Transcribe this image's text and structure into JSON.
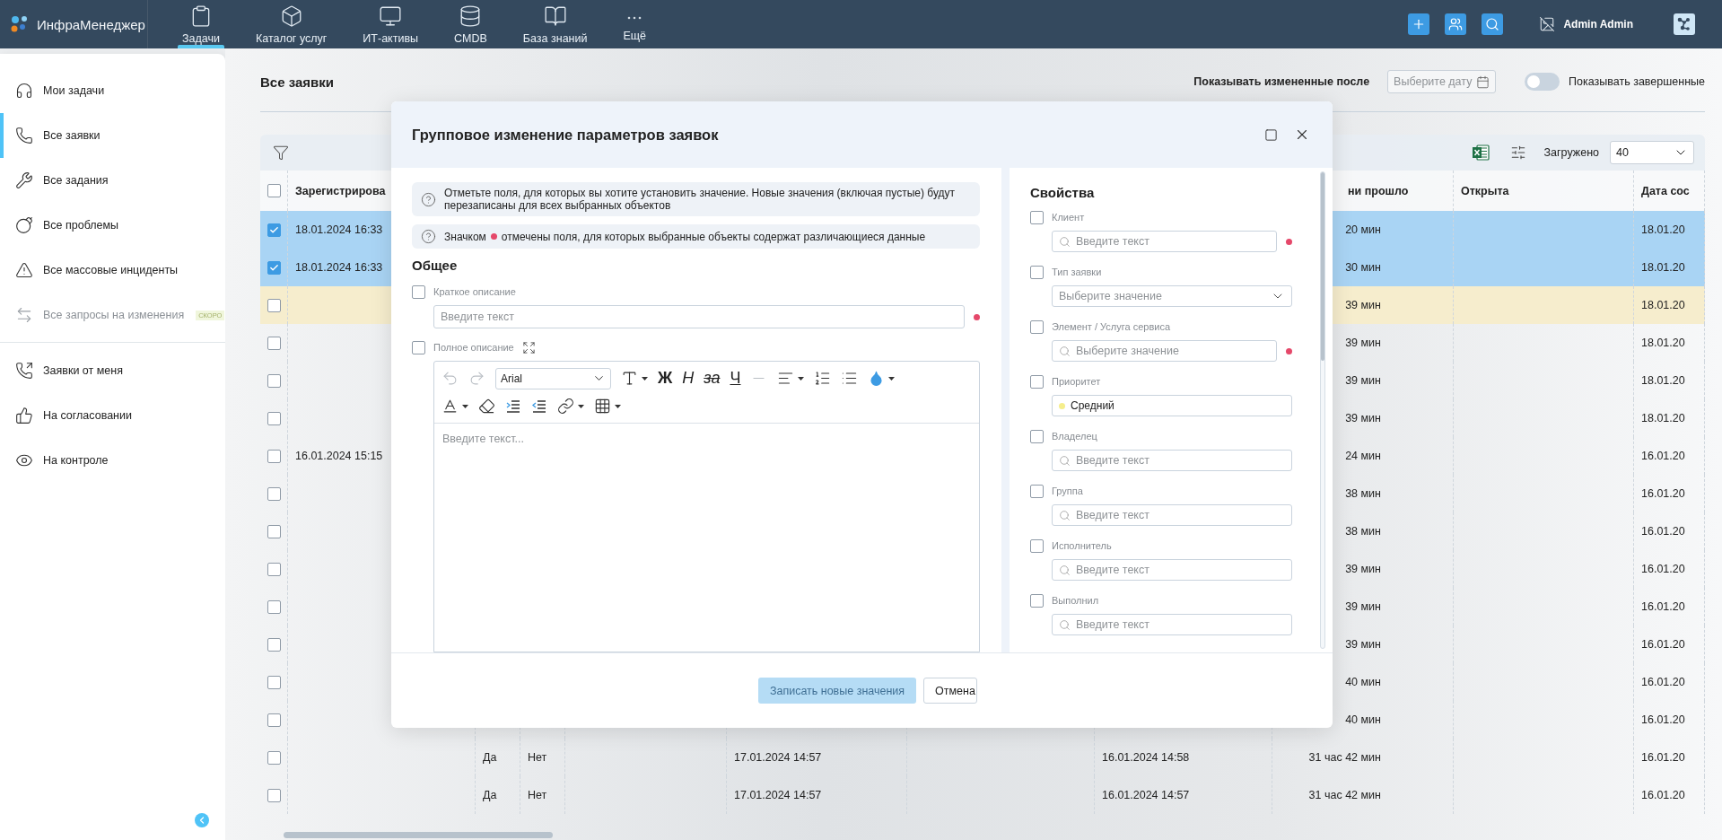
{
  "topbar": {
    "brand": "ИнфраМенеджер",
    "nav": [
      {
        "label": "Задачи",
        "selected": true
      },
      {
        "label": "Каталог услуг",
        "selected": false
      },
      {
        "label": "ИТ-активы",
        "selected": false
      },
      {
        "label": "CMDB",
        "selected": false
      },
      {
        "label": "База знаний",
        "selected": false
      },
      {
        "label": "Ещё",
        "selected": false
      }
    ],
    "actions": [
      {
        "kind": "add"
      },
      {
        "kind": "users"
      },
      {
        "kind": "search"
      }
    ],
    "user": {
      "name": "Admin Admin"
    }
  },
  "sidebar": {
    "groups": [
      [
        {
          "label": "Мои задачи",
          "selected": false,
          "disabled": false
        },
        {
          "label": "Все заявки",
          "selected": true,
          "disabled": false
        },
        {
          "label": "Все задания",
          "selected": false,
          "disabled": false
        },
        {
          "label": "Все проблемы",
          "selected": false,
          "disabled": false
        },
        {
          "label": "Все массовые инциденты",
          "selected": false,
          "disabled": false
        },
        {
          "label": "Все запросы на изменения",
          "selected": false,
          "disabled": true,
          "badge": "СКОРО"
        }
      ],
      [
        {
          "label": "Заявки от меня",
          "selected": false,
          "disabled": false
        },
        {
          "label": "На согласовании",
          "selected": false,
          "disabled": false
        },
        {
          "label": "На контроле",
          "selected": false,
          "disabled": false
        }
      ]
    ]
  },
  "page": {
    "title": "Все заявки",
    "changed_after": {
      "label": "Показывать измененные после",
      "placeholder": "Выберите дату"
    },
    "show_done": {
      "label": "Показывать завершенные",
      "on": false
    }
  },
  "table": {
    "loaded": {
      "label": "Загружено",
      "value": "40"
    },
    "header_checked": false,
    "columns": {
      "registered": "Зарегистрирова",
      "elapsed": "ни прошло",
      "opened": "Открыта",
      "date": "Дата сос"
    },
    "rows": [
      {
        "checked": true,
        "highlighted": false,
        "registered": "18.01.2024 16:33",
        "elapsed": "20 мин",
        "date": "18.01.20"
      },
      {
        "checked": true,
        "highlighted": false,
        "registered": "18.01.2024 16:33",
        "elapsed": "30 мин",
        "date": "18.01.20"
      },
      {
        "checked": false,
        "highlighted": true,
        "elapsed": "39 мин",
        "date": "18.01.20"
      },
      {
        "checked": false,
        "highlighted": false,
        "elapsed": "39 мин",
        "date": "18.01.20"
      },
      {
        "checked": false,
        "highlighted": false,
        "elapsed": "39 мин",
        "date": "18.01.20"
      },
      {
        "checked": false,
        "highlighted": false,
        "elapsed": "39 мин",
        "date": "18.01.20"
      },
      {
        "checked": false,
        "highlighted": false,
        "registered": "16.01.2024 15:15",
        "elapsed": "24 мин",
        "date": "16.01.20"
      },
      {
        "checked": false,
        "highlighted": false,
        "elapsed": "38 мин",
        "date": "16.01.20"
      },
      {
        "checked": false,
        "highlighted": false,
        "elapsed": "38 мин",
        "date": "16.01.20"
      },
      {
        "checked": false,
        "highlighted": false,
        "elapsed": "39 мин",
        "date": "16.01.20"
      },
      {
        "checked": false,
        "highlighted": false,
        "elapsed": "39 мин",
        "date": "16.01.20"
      },
      {
        "checked": false,
        "highlighted": false,
        "elapsed": "39 мин",
        "date": "16.01.20"
      },
      {
        "checked": false,
        "highlighted": false,
        "elapsed": "40 мин",
        "date": "16.01.20"
      },
      {
        "checked": false,
        "highlighted": false,
        "elapsed": "40 мин",
        "date": "16.01.20"
      },
      {
        "checked": false,
        "highlighted": false,
        "column_3": "Да",
        "column_4": "Нет",
        "column_6": "17.01.2024 14:57",
        "column_8": "16.01.2024 14:58",
        "elapsed": "31 час 42 мин",
        "date": "16.01.20"
      },
      {
        "checked": false,
        "highlighted": false,
        "column_3": "Да",
        "column_4": "Нет",
        "column_6": "17.01.2024 14:57",
        "column_8": "16.01.2024 14:57",
        "elapsed": "31 час 42 мин",
        "date": "16.01.20"
      }
    ]
  },
  "modal": {
    "title": "Групповое изменение параметров заявок",
    "info": [
      {
        "kind": "plain",
        "text": "Отметьте поля, для которых вы хотите установить значение. Новые значения (включая пустые) будут перезаписаны для всех выбранных объектов"
      },
      {
        "kind": "legend",
        "before": "Значком",
        "after": "отмечены поля, для которых выбранные объекты содержат различающиеся данные"
      }
    ],
    "general": {
      "heading": "Общее",
      "fields": [
        {
          "kind": "text",
          "label": "Краткое описание",
          "placeholder": "Введите текст",
          "checked": false,
          "differs": true
        },
        {
          "kind": "rich",
          "label": "Полное описание",
          "placeholder": "Введите текст...",
          "checked": false,
          "toolbar": [
            [
              {
                "kind": "undo",
                "disabled": true
              },
              {
                "kind": "redo",
                "disabled": true
              },
              {
                "kind": "font",
                "value": "Arial"
              },
              {
                "kind": "size",
                "caret": true
              },
              {
                "kind": "bold",
                "label": "Ж"
              },
              {
                "kind": "italic",
                "label": "Н"
              },
              {
                "kind": "strike",
                "label": "за"
              },
              {
                "kind": "underline",
                "label": "Ч"
              },
              {
                "kind": "rule",
                "disabled": true
              },
              {
                "kind": "align",
                "caret": true
              },
              {
                "kind": "ol"
              },
              {
                "kind": "ul"
              },
              {
                "kind": "color",
                "caret": true
              }
            ],
            [
              {
                "kind": "highlight",
                "caret": true
              },
              {
                "kind": "eraser"
              },
              {
                "kind": "indent"
              },
              {
                "kind": "outdent"
              },
              {
                "kind": "link",
                "caret": true
              },
              {
                "kind": "table",
                "caret": true
              }
            ]
          ]
        }
      ]
    },
    "properties": {
      "heading": "Свойства",
      "fields": [
        {
          "kind": "search",
          "label": "Клиент",
          "placeholder": "Введите текст",
          "checked": false,
          "differs": true
        },
        {
          "kind": "select",
          "label": "Тип заявки",
          "placeholder": "Выберите значение",
          "checked": false,
          "differs": false
        },
        {
          "kind": "search",
          "label": "Элемент / Услуга сервиса",
          "placeholder": "Выберите значение",
          "checked": false,
          "differs": true
        },
        {
          "kind": "value",
          "label": "Приоритет",
          "value": "Средний",
          "color": "#f5ee8c",
          "checked": false,
          "differs": false
        },
        {
          "kind": "search",
          "label": "Владелец",
          "placeholder": "Введите текст",
          "checked": false,
          "differs": false
        },
        {
          "kind": "search",
          "label": "Группа",
          "placeholder": "Введите текст",
          "checked": false,
          "differs": false
        },
        {
          "kind": "search",
          "label": "Исполнитель",
          "placeholder": "Введите текст",
          "checked": false,
          "differs": false
        },
        {
          "kind": "search",
          "label": "Выполнил",
          "placeholder": "Введите текст",
          "checked": false,
          "differs": false
        }
      ]
    },
    "buttons": [
      {
        "kind": "primary",
        "label": "Записать новые значения",
        "disabled": true
      },
      {
        "kind": "secondary",
        "label": "Отмена",
        "disabled": false
      }
    ]
  }
}
